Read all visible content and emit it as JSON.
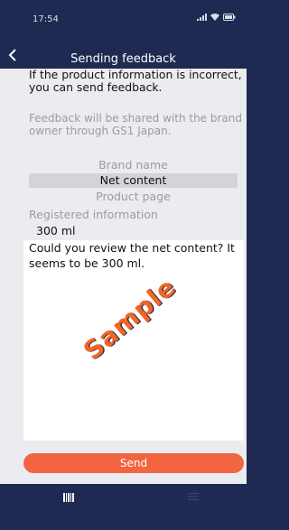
{
  "status": {
    "time": "17:54",
    "icons": [
      "signal-icon",
      "wifi-icon",
      "battery-icon"
    ]
  },
  "nav": {
    "title": "Sending feedback"
  },
  "intro": "If the product information is incorrect, you can send feedback.",
  "note": "Feedback will be shared with the brand owner through GS1 Japan.",
  "options": {
    "brand": "Brand name",
    "net": "Net content",
    "page": "Product page",
    "selected": "Net content"
  },
  "registered": {
    "label": "Registered information",
    "value": "300 ml"
  },
  "message": "Could you review the net content? It seems to be 300 ml.",
  "watermark": "Sample",
  "send_label": "Send",
  "tabs": [
    "barcode-icon",
    "menu-icon"
  ],
  "colors": {
    "navy": "#1e2a52",
    "accent": "#f26540",
    "watermark": "#f26522"
  }
}
